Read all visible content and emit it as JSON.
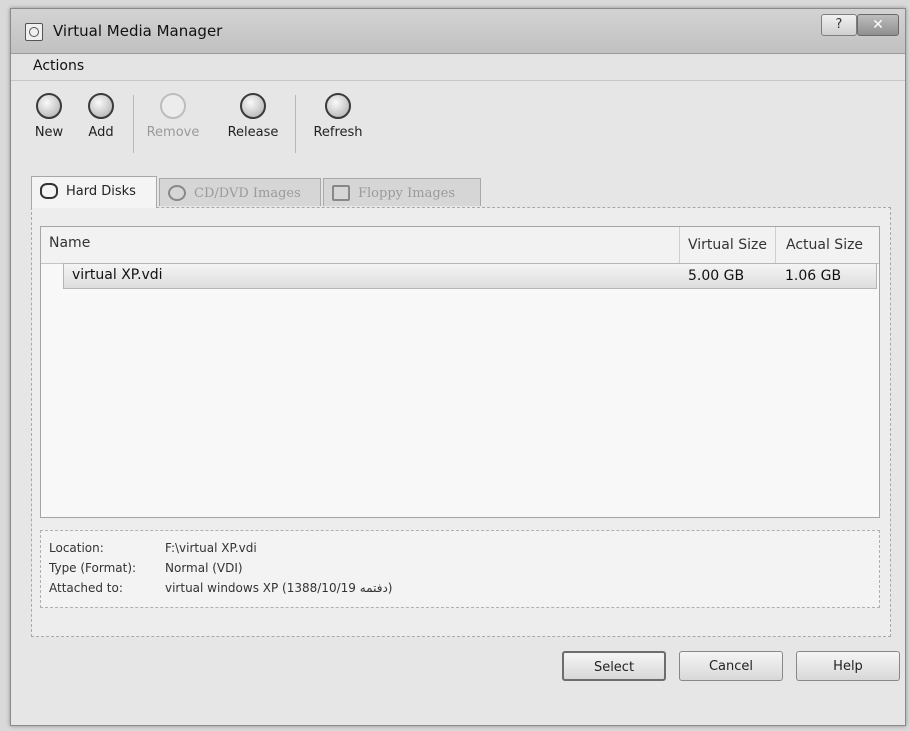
{
  "window": {
    "title": "Virtual Media Manager",
    "help_glyph": "?",
    "close_glyph": "✕"
  },
  "menu": {
    "actions": "Actions"
  },
  "toolbar": {
    "new": "New",
    "add": "Add",
    "remove": "Remove",
    "release": "Release",
    "refresh": "Refresh"
  },
  "tabs": {
    "hard_disks": "Hard Disks",
    "cd_dvd": "CD/DVD Images",
    "floppy": "Floppy Images",
    "active": "hard_disks"
  },
  "table": {
    "columns": {
      "name": "Name",
      "virtual_size": "Virtual Size",
      "actual_size": "Actual Size"
    },
    "rows": [
      {
        "name": "virtual XP.vdi",
        "virtual_size": "5.00 GB",
        "actual_size": "1.06 GB"
      }
    ]
  },
  "details": {
    "location_label": "Location:",
    "location_value": "F:\\virtual XP.vdi",
    "type_label": "Type (Format):",
    "type_value": "Normal (VDI)",
    "attached_label": "Attached to:",
    "attached_value": "virtual windows XP (1388/10/19 دفتمه)"
  },
  "buttons": {
    "select": "Select",
    "cancel": "Cancel",
    "help": "Help"
  }
}
